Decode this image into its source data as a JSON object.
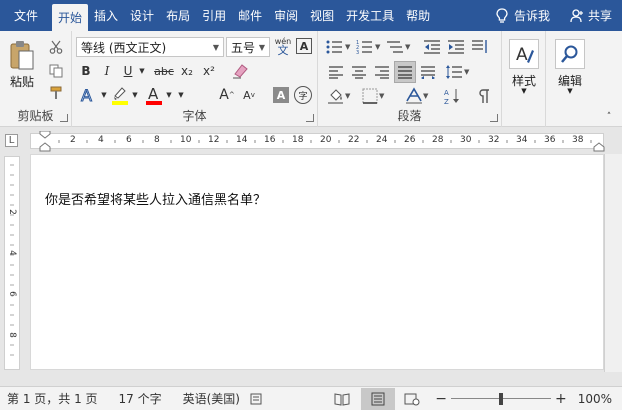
{
  "tabs": [
    {
      "id": "file",
      "label": "文件"
    },
    {
      "id": "home",
      "label": "开始"
    },
    {
      "id": "insert",
      "label": "插入"
    },
    {
      "id": "design",
      "label": "设计"
    },
    {
      "id": "layout",
      "label": "布局"
    },
    {
      "id": "references",
      "label": "引用"
    },
    {
      "id": "mailings",
      "label": "邮件"
    },
    {
      "id": "review",
      "label": "审阅"
    },
    {
      "id": "view",
      "label": "视图"
    },
    {
      "id": "developer",
      "label": "开发工具"
    },
    {
      "id": "help",
      "label": "帮助"
    }
  ],
  "tell_me": {
    "label": "告诉我",
    "icon": "lightbulb-icon"
  },
  "share": {
    "label": "共享",
    "icon": "person-icon"
  },
  "ribbon": {
    "clipboard": {
      "label": "剪贴板",
      "paste_label": "粘贴"
    },
    "font": {
      "label": "字体",
      "font_name": "等线 (西文正文)",
      "font_size": "五号",
      "phonetic_top": "wén",
      "phonetic_bottom": "文",
      "char_border": "A",
      "bold": "B",
      "italic": "I",
      "underline": "U",
      "strike": "abc",
      "subscript": "x₂",
      "superscript": "x²",
      "grow": "A",
      "shrink": "A",
      "char_shading": "A",
      "enclose": "字"
    },
    "paragraph": {
      "label": "段落"
    },
    "styles": {
      "label": "样式"
    },
    "editing": {
      "label": "编辑"
    }
  },
  "ruler": {
    "h_numbers": [
      "2",
      "4",
      "6",
      "8",
      "10",
      "12",
      "14",
      "16",
      "18",
      "20",
      "22",
      "24",
      "26",
      "28",
      "30",
      "32",
      "34",
      "36",
      "38"
    ],
    "v_numbers": [
      "2",
      "4",
      "6",
      "8"
    ],
    "tab_selector": "L"
  },
  "document": {
    "text": "你是否希望将某些人拉入通信黑名单？"
  },
  "status": {
    "page": "第 1 页，共 1 页",
    "words": "17 个字",
    "language": "英语(美国)",
    "zoom": "100%",
    "zoom_level": 1.0
  },
  "colors": {
    "accent": "#2b579a",
    "highlight": "#ffff00",
    "font_color": "#ff0000"
  }
}
